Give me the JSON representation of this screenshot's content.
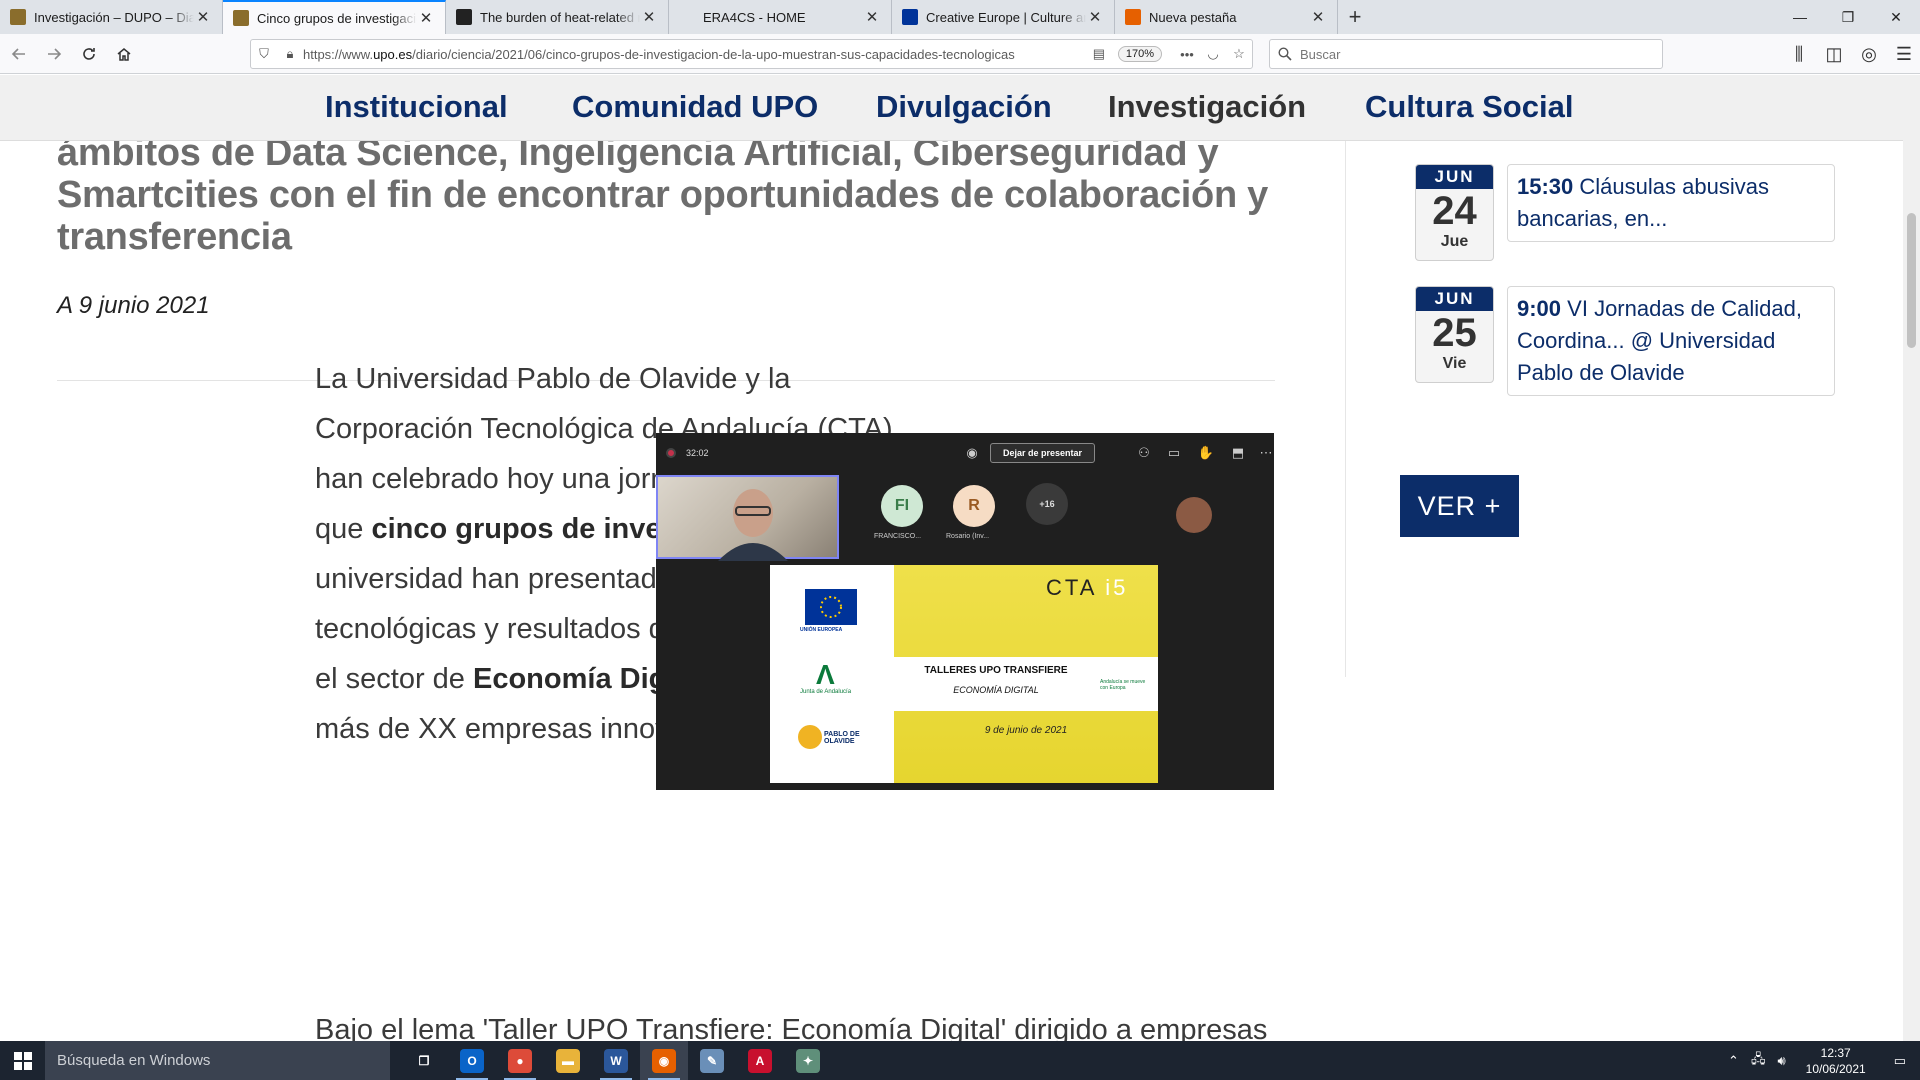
{
  "browser": {
    "tabs": [
      {
        "title": "Investigación – DUPO – Diario de la Universidad",
        "favicon_color": "#8a6d2c",
        "active": false
      },
      {
        "title": "Cinco grupos de investigación de la UPO",
        "favicon_color": "#8a6d2c",
        "active": true
      },
      {
        "title": "The burden of heat-related mortality",
        "favicon_color": "#222222",
        "active": false
      },
      {
        "title": "ERA4CS - HOME",
        "favicon_color": "",
        "active": false
      },
      {
        "title": "Creative Europe | Culture and Creativity",
        "favicon_color": "#003399",
        "active": false
      },
      {
        "title": "Nueva pestaña",
        "favicon_color": "#e66000",
        "active": false
      }
    ],
    "close_glyph": "✕",
    "new_tab_glyph": "+",
    "window_controls": {
      "minimize": "—",
      "restore": "❐",
      "close": "✕"
    },
    "url": {
      "prefix": "https://www.",
      "domain": "upo.es",
      "path": "/diario/ciencia/2021/06/cinco-grupos-de-investigacion-de-la-upo-muestran-sus-capacidades-tecnologicas"
    },
    "zoom": "170%",
    "search_placeholder": "Buscar"
  },
  "site_nav": {
    "items": [
      "Institucional",
      "Comunidad UPO",
      "Divulgación",
      "Investigación",
      "Cultura Social"
    ],
    "current": "Investigación",
    "color": "#0c2d69"
  },
  "article": {
    "subtitle_lines": [
      "ámbitos de Data Science, Ingeligencia Artificial, Ciberseguridad y",
      "Smartcities con el fin de encontrar oportunidades de colaboración y",
      "transferencia"
    ],
    "date": "A 9 junio 2021",
    "para1": {
      "t1": "La Universidad Pablo de Olavide  y  la Corporación Tecnológica de Andalucía (CTA) han celebrado hoy una jornada online en la que ",
      "b1": "cinco grupos de investigación",
      "t2": " de esta universidad han presentado sus capacidades tecnológicas y resultados de investigación en el sector de ",
      "b2": "Economía Digital",
      "t3": " a un grupo de más de XX empresas innovadoras."
    },
    "para2_visible_start": "Bajo el lema 'Taller UPO Transfiere: Economía Digital' dirigido a empresas"
  },
  "meeting_image": {
    "timer": "32:02",
    "stop_label": "Dejar de presentar",
    "participants": [
      {
        "initials": "FI",
        "name": "FRANCISCO...",
        "color": "#cfe8d4",
        "text_color": "#3a7d4a"
      },
      {
        "initials": "R",
        "name": "Rosario (Inv...",
        "color": "#f6dcc4",
        "text_color": "#9a5a22"
      }
    ],
    "more_count": "+16",
    "slide": {
      "brand": "CTA",
      "brand_suffix": "i5",
      "title": "TALLERES UPO TRANSFIERE",
      "subtitle": "ECONOMÍA DIGITAL",
      "date": "9 de junio de 2021",
      "logos": [
        "UNIÓN EUROPEA",
        "Junta de Andalucía",
        "PABLO DE OLAVIDE"
      ],
      "tag": "Andalucía se mueve con Europa"
    }
  },
  "events": [
    {
      "month": "JUN",
      "day": "24",
      "weekday": "Jue",
      "time": "15:30",
      "title": "Cláusulas abusivas bancarias, en..."
    },
    {
      "month": "JUN",
      "day": "25",
      "weekday": "Vie",
      "time": "9:00",
      "title": "VI Jornadas de Calidad, Coordina... @ Universidad Pablo de Olavide"
    }
  ],
  "ver_mas": "VER +",
  "taskbar": {
    "search_placeholder": "Búsqueda en Windows",
    "apps": [
      {
        "name": "task-view",
        "glyph": "❐",
        "color": "transparent",
        "open": false
      },
      {
        "name": "outlook",
        "glyph": "O",
        "color": "#0a64c8",
        "open": true
      },
      {
        "name": "chrome",
        "glyph": "●",
        "color": "#dd4b39",
        "open": true
      },
      {
        "name": "file-explorer",
        "glyph": "▬",
        "color": "#e8b33a",
        "open": false
      },
      {
        "name": "word",
        "glyph": "W",
        "color": "#2b579a",
        "open": true
      },
      {
        "name": "firefox",
        "glyph": "◉",
        "color": "#e66000",
        "open": true
      },
      {
        "name": "notes",
        "glyph": "✎",
        "color": "#6a8fb8",
        "open": false
      },
      {
        "name": "acrobat",
        "glyph": "A",
        "color": "#c8102e",
        "open": false
      },
      {
        "name": "other-app",
        "glyph": "✦",
        "color": "#5f8f7a",
        "open": false
      }
    ],
    "time": "12:37",
    "date": "10/06/2021"
  }
}
